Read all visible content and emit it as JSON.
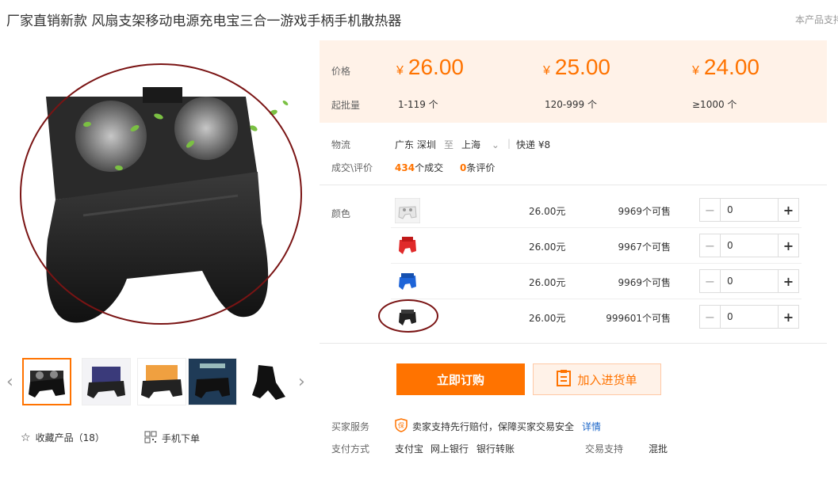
{
  "header": {
    "title": "厂家直销新款 风扇支架移动电源充电宝三合一游戏手柄手机散热器",
    "right_note": "本产品支持"
  },
  "gallery": {
    "prev_icon": "‹",
    "next_icon": "›",
    "thumb_count": 5,
    "active_index": 0
  },
  "actions": {
    "favorite_label": "收藏产品（18）",
    "mobile_order_label": "手机下单"
  },
  "price_box": {
    "price_label": "价格",
    "moq_label": "起批量",
    "currency": "¥",
    "tiers": [
      {
        "price": "26.00",
        "range": "1-119 个"
      },
      {
        "price": "25.00",
        "range": "120-999 个"
      },
      {
        "price": "24.00",
        "range": "≥1000 个"
      }
    ]
  },
  "logistics": {
    "label": "物流",
    "from": "广东 深圳",
    "to_word": "至",
    "to": "上海",
    "shipping": "快递 ¥8"
  },
  "deals": {
    "label": "成交\\评价",
    "deal_count": "434",
    "deal_suffix": "个成交",
    "review_count": "0",
    "review_suffix": "条评价"
  },
  "sku": {
    "label": "颜色",
    "rows": [
      {
        "color_name": "white",
        "price": "26.00元",
        "stock": "9969个可售",
        "qty": "0"
      },
      {
        "color_name": "red",
        "price": "26.00元",
        "stock": "9967个可售",
        "qty": "0"
      },
      {
        "color_name": "blue",
        "price": "26.00元",
        "stock": "9969个可售",
        "qty": "0"
      },
      {
        "color_name": "black",
        "price": "26.00元",
        "stock": "999601个可售",
        "qty": "0"
      }
    ]
  },
  "buttons": {
    "order": "立即订购",
    "cart": "加入进货单"
  },
  "service": {
    "label": "买家服务",
    "text": "卖家支持先行赔付，保障买家交易安全",
    "detail_link": "详情"
  },
  "payment": {
    "label": "支付方式",
    "methods": [
      "支付宝",
      "网上银行",
      "银行转账"
    ],
    "trade_label": "交易支持",
    "trade_value": "混批"
  },
  "colors": {
    "accent": "#ff7300",
    "price_bg": "#fff2e8",
    "annotation": "#7a1414",
    "link": "#1b66c9"
  }
}
